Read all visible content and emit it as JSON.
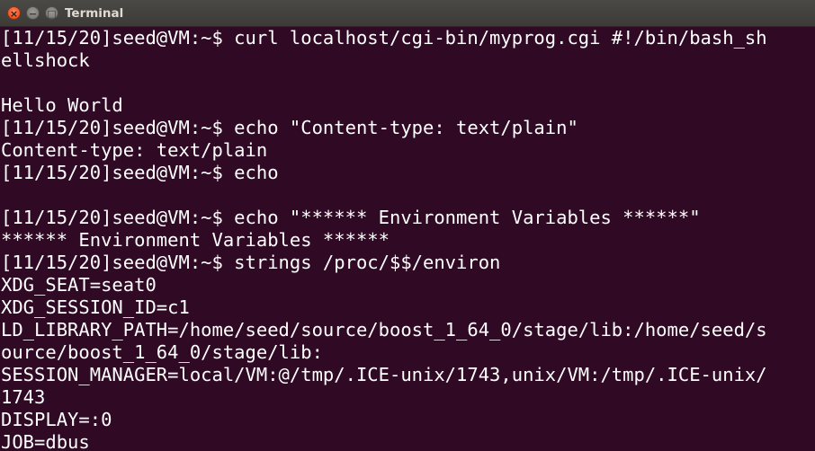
{
  "window": {
    "title": "Terminal",
    "close_symbol": "×",
    "minimize_symbol": "−",
    "maximize_symbol": "□"
  },
  "colors": {
    "terminal_background": "#300a24",
    "terminal_foreground": "#ffffff",
    "titlebar": "#3c3b37",
    "close_button": "#e95420"
  },
  "terminal": {
    "lines": [
      "[11/15/20]seed@VM:~$ curl localhost/cgi-bin/myprog.cgi #!/bin/bash_sh",
      "ellshock",
      "",
      "Hello World",
      "[11/15/20]seed@VM:~$ echo \"Content-type: text/plain\"",
      "Content-type: text/plain",
      "[11/15/20]seed@VM:~$ echo",
      "",
      "[11/15/20]seed@VM:~$ echo \"****** Environment Variables ******\"",
      "****** Environment Variables ******",
      "[11/15/20]seed@VM:~$ strings /proc/$$/environ",
      "XDG_SEAT=seat0",
      "XDG_SESSION_ID=c1",
      "LD_LIBRARY_PATH=/home/seed/source/boost_1_64_0/stage/lib:/home/seed/s",
      "ource/boost_1_64_0/stage/lib:",
      "SESSION_MANAGER=local/VM:@/tmp/.ICE-unix/1743,unix/VM:/tmp/.ICE-unix/",
      "1743",
      "DISPLAY=:0",
      "JOB=dbus"
    ]
  }
}
